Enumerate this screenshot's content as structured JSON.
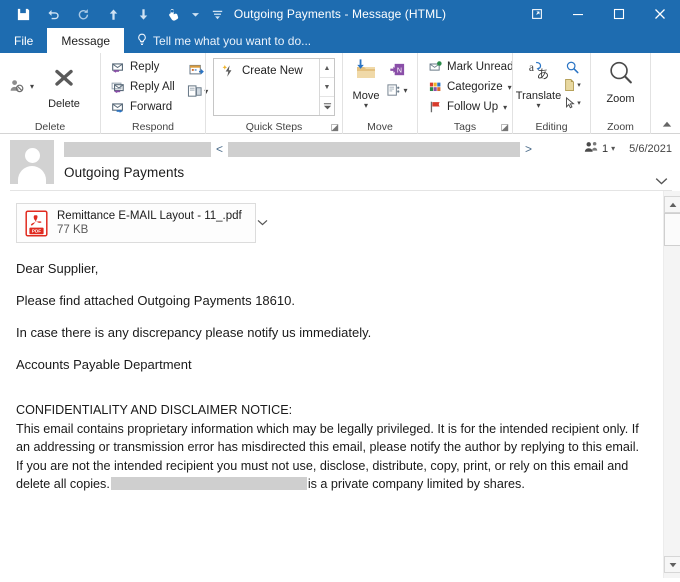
{
  "window": {
    "title": "Outgoing Payments - Message (HTML)",
    "accent_color": "#1e6cb0",
    "quick_access": [
      {
        "name": "save-icon",
        "tooltip": "Save"
      },
      {
        "name": "undo-icon",
        "tooltip": "Undo"
      },
      {
        "name": "redo-icon",
        "tooltip": "Redo"
      },
      {
        "name": "previous-item-icon",
        "tooltip": "Previous Item"
      },
      {
        "name": "next-item-icon",
        "tooltip": "Next Item"
      },
      {
        "name": "touch-mouse-mode-icon",
        "tooltip": "Touch/Mouse Mode"
      },
      {
        "name": "customize-quick-access-toolbar-icon",
        "tooltip": "Customize Quick Access Toolbar"
      }
    ],
    "controls": {
      "restore_down": "Restore Down",
      "minimize": "Minimize",
      "maximize": "Maximize",
      "close": "Close"
    }
  },
  "tabs": {
    "file": "File",
    "message": "Message",
    "tellme_placeholder": "Tell me what you want to do..."
  },
  "ribbon": {
    "groups": [
      {
        "label": "Delete",
        "buttons": [
          {
            "label": "Ignore",
            "icon": "ignore-person-icon"
          },
          {
            "label": "Delete",
            "icon": "delete-x-icon"
          }
        ]
      },
      {
        "label": "Respond",
        "buttons": [
          {
            "label": "Reply",
            "icon": "reply-icon"
          },
          {
            "label": "Reply All",
            "icon": "reply-all-icon"
          },
          {
            "label": "Forward",
            "icon": "forward-icon"
          },
          {
            "label": "Meeting",
            "icon": "meeting-icon"
          },
          {
            "label": "More Respond Actions",
            "icon": "more-respond-icon"
          }
        ]
      },
      {
        "label": "Quick Steps",
        "items": [
          {
            "label": "Create New",
            "icon": "quick-step-lightning-icon"
          }
        ],
        "launcher": "Quick Steps dialog launcher"
      },
      {
        "label": "Move",
        "buttons": [
          {
            "label": "Move",
            "icon": "move-folder-icon"
          },
          {
            "label": "OneNote",
            "icon": "onenote-icon"
          },
          {
            "label": "Rules",
            "icon": "rules-icon"
          }
        ]
      },
      {
        "label": "Tags",
        "buttons": [
          {
            "label": "Mark Unread",
            "icon": "mark-unread-icon"
          },
          {
            "label": "Categorize",
            "icon": "categorize-icon"
          },
          {
            "label": "Follow Up",
            "icon": "follow-up-flag-icon"
          }
        ],
        "launcher": "Tags dialog launcher"
      },
      {
        "label": "Editing",
        "buttons": [
          {
            "label": "Translate",
            "icon": "translate-icon"
          },
          {
            "label": "Find",
            "icon": "find-magnifier-icon"
          },
          {
            "label": "Related",
            "icon": "related-document-icon"
          },
          {
            "label": "Select",
            "icon": "select-cursor-icon"
          }
        ]
      },
      {
        "label": "Zoom",
        "buttons": [
          {
            "label": "Zoom",
            "icon": "zoom-magnifier-icon"
          }
        ]
      }
    ],
    "collapse_tooltip": "Collapse the Ribbon"
  },
  "message": {
    "sender_name_redacted": true,
    "sender_email_redacted": true,
    "angle_open": "<",
    "angle_close": ">",
    "subject": "Outgoing Payments",
    "recipient_count": "1",
    "date": "5/6/2021",
    "expand_tooltip": "Expand",
    "attachment": {
      "name": "Remittance E-MAIL Layout - 11_.pdf",
      "size": "77 KB",
      "icon": "pdf-file-icon",
      "caret": "Attachment options"
    },
    "body": {
      "greeting": "Dear Supplier,",
      "line1": "Please find attached Outgoing Payments 18610.",
      "line2": "In case there is any discrepancy please notify us immediately.",
      "line3": "Accounts Payable Department",
      "disclaimer_title": "CONFIDENTIALITY AND DISCLAIMER NOTICE:",
      "disclaimer_part1": "This email contains proprietary information which may be legally privileged. It is for the intended recipient only. If an addressing or transmission error has misdirected this email, please notify the author by replying to this email. If you are not the intended recipient you must not use, disclose, distribute, copy, print, or rely on this email and delete all copies.",
      "disclaimer_part2": "is a private company limited by shares."
    }
  },
  "scrollbar": {
    "up": "Scroll up",
    "down": "Scroll down",
    "thumb": "Scroll position"
  }
}
